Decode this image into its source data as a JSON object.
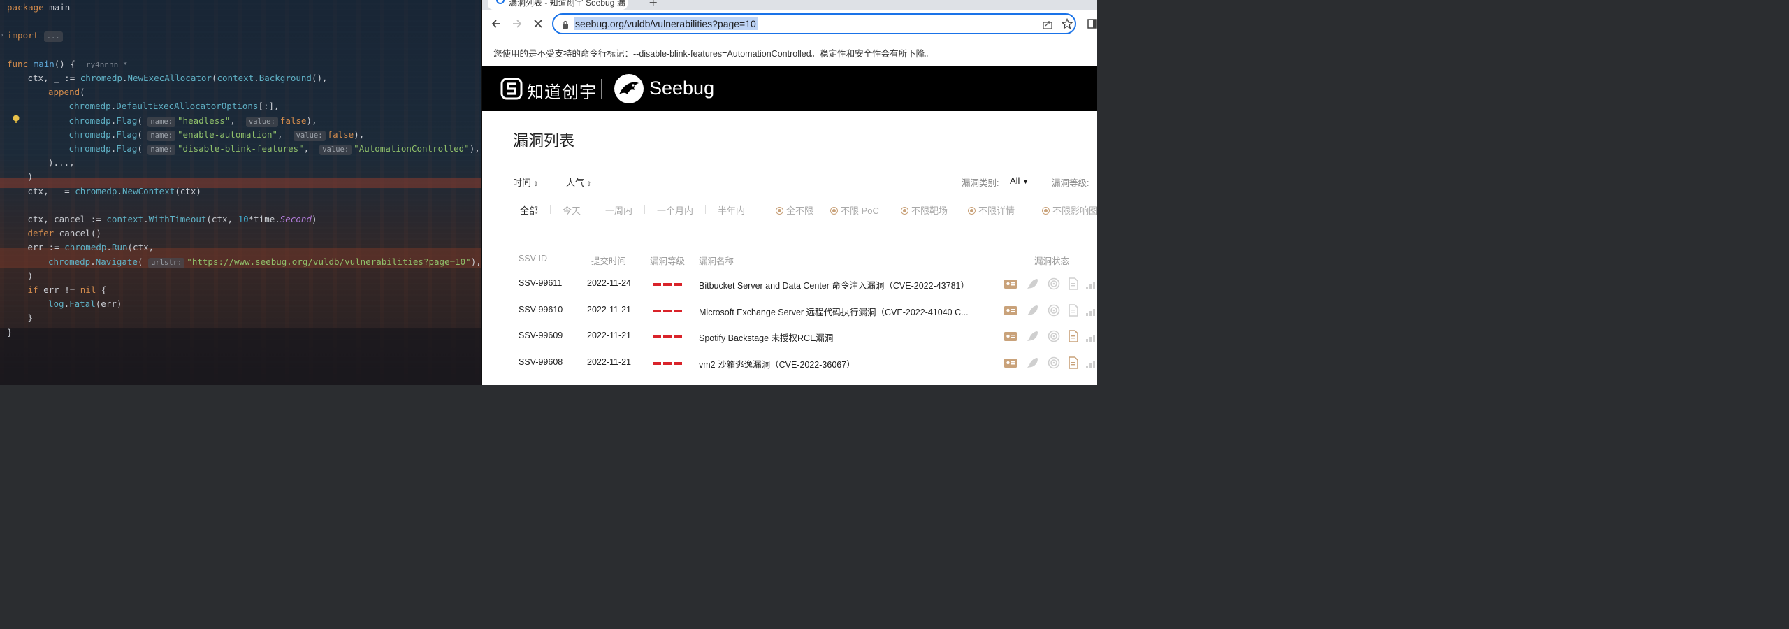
{
  "editor": {
    "lines": [
      {
        "indent": 0,
        "parts": [
          [
            "kw",
            "package"
          ],
          [
            "pkg",
            " main"
          ]
        ]
      },
      {
        "indent": 0,
        "parts": []
      },
      {
        "indent": 0,
        "fold": true,
        "parts": [
          [
            "kw",
            "import"
          ],
          [
            "pkg",
            " "
          ],
          [
            "hint",
            "..."
          ]
        ]
      },
      {
        "indent": 0,
        "parts": []
      },
      {
        "indent": 0,
        "parts": [
          [
            "kw",
            "func"
          ],
          [
            "pkg",
            " "
          ],
          [
            "fn",
            "main"
          ],
          [
            "pkg",
            "() {  "
          ],
          [
            "author",
            "ry4nnnn *"
          ]
        ]
      },
      {
        "indent": 1,
        "parts": [
          [
            "pkg",
            "ctx, _ := "
          ],
          [
            "call",
            "chromedp"
          ],
          [
            "pkg",
            "."
          ],
          [
            "call",
            "NewExecAllocator"
          ],
          [
            "pkg",
            "("
          ],
          [
            "call",
            "context"
          ],
          [
            "pkg",
            "."
          ],
          [
            "call",
            "Background"
          ],
          [
            "pkg",
            "(),"
          ]
        ]
      },
      {
        "indent": 2,
        "parts": [
          [
            "kw",
            "append"
          ],
          [
            "pkg",
            "("
          ]
        ]
      },
      {
        "indent": 3,
        "parts": [
          [
            "call",
            "chromedp"
          ],
          [
            "pkg",
            "."
          ],
          [
            "call",
            "DefaultExecAllocatorOptions"
          ],
          [
            "pkg",
            "[:],"
          ]
        ]
      },
      {
        "indent": 3,
        "parts": [
          [
            "call",
            "chromedp"
          ],
          [
            "pkg",
            "."
          ],
          [
            "call",
            "Flag"
          ],
          [
            "pkg",
            "( "
          ],
          [
            "hint",
            "name:"
          ],
          [
            "str",
            "\"headless\""
          ],
          [
            "pkg",
            ",  "
          ],
          [
            "hint",
            "value:"
          ],
          [
            "kw",
            "false"
          ],
          [
            "pkg",
            "),"
          ]
        ]
      },
      {
        "indent": 3,
        "parts": [
          [
            "call",
            "chromedp"
          ],
          [
            "pkg",
            "."
          ],
          [
            "call",
            "Flag"
          ],
          [
            "pkg",
            "( "
          ],
          [
            "hint",
            "name:"
          ],
          [
            "str",
            "\"enable-automation\""
          ],
          [
            "pkg",
            ",  "
          ],
          [
            "hint",
            "value:"
          ],
          [
            "kw",
            "false"
          ],
          [
            "pkg",
            "),"
          ]
        ]
      },
      {
        "indent": 3,
        "parts": [
          [
            "call",
            "chromedp"
          ],
          [
            "pkg",
            "."
          ],
          [
            "call",
            "Flag"
          ],
          [
            "pkg",
            "( "
          ],
          [
            "hint",
            "name:"
          ],
          [
            "str",
            "\"disable-blink-features\""
          ],
          [
            "pkg",
            ",  "
          ],
          [
            "hint",
            "value:"
          ],
          [
            "str",
            "\"AutomationControlled\""
          ],
          [
            "pkg",
            "),"
          ]
        ]
      },
      {
        "indent": 2,
        "parts": [
          [
            "pkg",
            ")...,"
          ]
        ]
      },
      {
        "indent": 1,
        "parts": [
          [
            "pkg",
            ")"
          ]
        ]
      },
      {
        "indent": 1,
        "parts": [
          [
            "pkg",
            "ctx, _ = "
          ],
          [
            "call",
            "chromedp"
          ],
          [
            "pkg",
            "."
          ],
          [
            "call",
            "NewContext"
          ],
          [
            "pkg",
            "(ctx)"
          ]
        ]
      },
      {
        "indent": 0,
        "parts": []
      },
      {
        "indent": 1,
        "parts": [
          [
            "pkg",
            "ctx, cancel := "
          ],
          [
            "call",
            "context"
          ],
          [
            "pkg",
            "."
          ],
          [
            "call",
            "WithTimeout"
          ],
          [
            "pkg",
            "(ctx, "
          ],
          [
            "num",
            "10"
          ],
          [
            "pkg",
            "*time."
          ],
          [
            "it",
            "Second"
          ],
          [
            "pkg",
            ")"
          ]
        ]
      },
      {
        "indent": 1,
        "parts": [
          [
            "kw",
            "defer"
          ],
          [
            "pkg",
            " cancel()"
          ]
        ]
      },
      {
        "indent": 1,
        "parts": [
          [
            "pkg",
            "err := "
          ],
          [
            "call",
            "chromedp"
          ],
          [
            "pkg",
            "."
          ],
          [
            "call",
            "Run"
          ],
          [
            "pkg",
            "(ctx,"
          ]
        ]
      },
      {
        "indent": 2,
        "parts": [
          [
            "call",
            "chromedp"
          ],
          [
            "pkg",
            "."
          ],
          [
            "call",
            "Navigate"
          ],
          [
            "pkg",
            "( "
          ],
          [
            "hint",
            "urlstr:"
          ],
          [
            "str",
            "\"https://www.seebug.org/vuldb/vulnerabilities?page=10\""
          ],
          [
            "pkg",
            "),"
          ]
        ]
      },
      {
        "indent": 1,
        "parts": [
          [
            "pkg",
            ")"
          ]
        ]
      },
      {
        "indent": 1,
        "parts": [
          [
            "kw",
            "if"
          ],
          [
            "pkg",
            " err != "
          ],
          [
            "kw",
            "nil"
          ],
          [
            "pkg",
            " {"
          ]
        ]
      },
      {
        "indent": 2,
        "parts": [
          [
            "call",
            "log"
          ],
          [
            "pkg",
            "."
          ],
          [
            "call",
            "Fatal"
          ],
          [
            "pkg",
            "(err)"
          ]
        ]
      },
      {
        "indent": 1,
        "parts": [
          [
            "pkg",
            "}"
          ]
        ]
      },
      {
        "indent": 0,
        "parts": [
          [
            "pkg",
            "}"
          ]
        ]
      }
    ]
  },
  "browser": {
    "tab_title": "漏洞列表 - 知道创宇 Seebug 漏",
    "new_tab": "+",
    "url": "seebug.org/vuldb/vulnerabilities?page=10",
    "infobar": "您使用的是不受支持的命令行标记：--disable-blink-features=AutomationControlled。稳定性和安全性会有所下降。"
  },
  "site": {
    "brand_cn": "知道创宇",
    "brand_en": "Seebug",
    "page_title": "漏洞列表",
    "sort_time": "时间",
    "sort_popularity": "人气",
    "filter_type_label": "漏洞类别:",
    "filter_type_value": "All",
    "filter_level_label": "漏洞等级:",
    "ranges": [
      "全部",
      "今天",
      "一周内",
      "一个月内",
      "半年内"
    ],
    "radios": [
      "全不限",
      "不限 PoC",
      "不限靶场",
      "不限详情",
      "不限影响图"
    ],
    "table_headers": {
      "id": "SSV ID",
      "date": "提交时间",
      "level": "漏洞等级",
      "name": "漏洞名称",
      "status": "漏洞状态"
    },
    "rows": [
      {
        "id": "SSV-99611",
        "date": "2022-11-24",
        "name": "Bitbucket Server and Data Center 命令注入漏洞（CVE-2022-43781）",
        "level": 3
      },
      {
        "id": "SSV-99610",
        "date": "2022-11-21",
        "name": "Microsoft Exchange Server 远程代码执行漏洞（CVE-2022-41040 C...",
        "level": 3
      },
      {
        "id": "SSV-99609",
        "date": "2022-11-21",
        "name": "Spotify Backstage 未授权RCE漏洞",
        "level": 3
      },
      {
        "id": "SSV-99608",
        "date": "2022-11-21",
        "name": "vm2 沙箱逃逸漏洞（CVE-2022-36067）",
        "level": 3
      }
    ]
  },
  "colors": {
    "accent": "#1a73e8",
    "severity_high": "#d9232a",
    "status_gold": "#c9a27a"
  }
}
